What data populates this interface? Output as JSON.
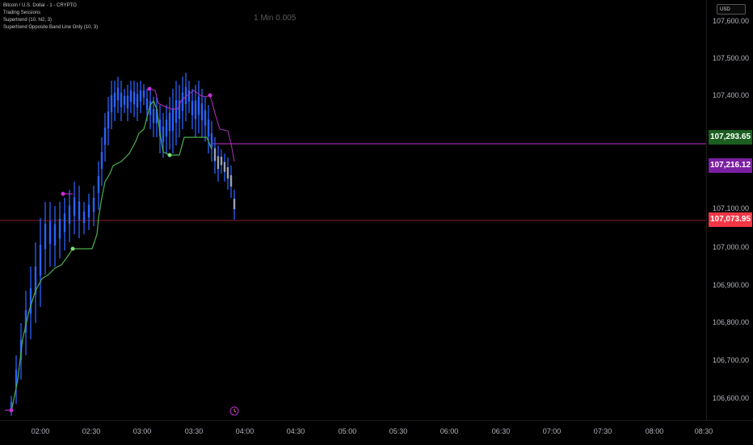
{
  "legend": {
    "symbol": "Bitcoin / U.S. Dollar - 1 - CRYPTO",
    "indicators": [
      "Trading Sessions",
      "Supertrend (10, hl2, 3)",
      "Supertrend Opposite Band Line Only (10, 3)"
    ]
  },
  "watermark": "1 Min 0.005",
  "currency": "USD",
  "price_axis": {
    "ticks": [
      "107,600.00",
      "107,500.00",
      "107,400.00",
      "107,100.00",
      "107,000.00",
      "106,900.00",
      "106,800.00",
      "106,700.00",
      "106,600.00"
    ],
    "labels": [
      {
        "text": "107,293.65",
        "color": "#1b5e20"
      },
      {
        "text": "107,216.12",
        "color": "#7b1fa2"
      },
      {
        "text": "107,073.95",
        "color": "#f23645"
      }
    ]
  },
  "time_axis": {
    "ticks": [
      "02:00",
      "02:30",
      "03:00",
      "03:30",
      "04:00",
      "04:30",
      "05:00",
      "05:30",
      "06:00",
      "06:30",
      "07:00",
      "07:30",
      "08:00",
      "08:30"
    ]
  },
  "colors": {
    "candles": "#2962ff",
    "supertrend_up": "#4caf50",
    "supertrend_down": "#e040fb",
    "opposite_band": "#9c27b0",
    "last_price_line": "#8b2230"
  },
  "icons": {
    "session_marker": "clock-icon"
  }
}
